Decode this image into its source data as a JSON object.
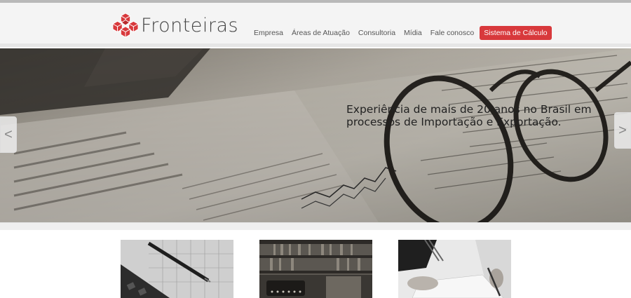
{
  "brand": {
    "name": "Fronteiras",
    "accent_color": "#d8393c",
    "logo_icon": "red-cube-cluster-icon"
  },
  "nav": {
    "items": [
      {
        "label": "Empresa"
      },
      {
        "label": "Áreas de Atuação"
      },
      {
        "label": "Consultoria"
      },
      {
        "label": "Mídia"
      },
      {
        "label": "Fale conosco"
      }
    ],
    "cta_label": "Sistema de Cálculo"
  },
  "slider": {
    "caption": "Experiência de mais de 20 anos no Brasil em processos de Importação e Exportação.",
    "prev_label": "<",
    "next_label": ">",
    "image": "newspaper-stock-listings-with-eyeglasses"
  },
  "thumbnails": [
    {
      "image": "calculator-pen-chart"
    },
    {
      "image": "typewriter-bookshelf-library"
    },
    {
      "image": "handshake-contract-signing"
    }
  ]
}
